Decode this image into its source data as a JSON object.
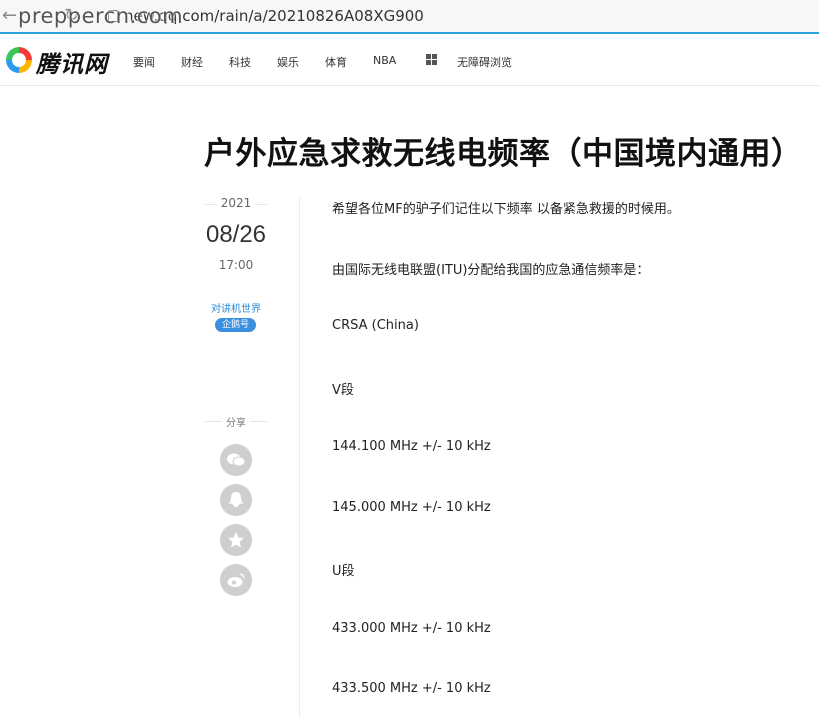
{
  "browser": {
    "back_glyph": "←",
    "reload_glyph": "↻",
    "watermark": "preppercn.com",
    "url": "new.qq.com/rain/a/20210826A08XG900"
  },
  "site": {
    "logo_text": "腾讯网",
    "nav": [
      "要闻",
      "财经",
      "科技",
      "娱乐",
      "体育",
      "NBA"
    ],
    "accessibility": "无障碍浏览"
  },
  "article": {
    "title": "户外应急求救无线电频率（中国境内通用）",
    "year": "2021",
    "date": "08/26",
    "time": "17:00",
    "author": "对讲机世界",
    "badge": "企鹅号",
    "share_label": "分享",
    "paragraphs": [
      "希望各位MF的驴子们记住以下频率 以备紧急救援的时候用。",
      "由国际无线电联盟(ITU)分配给我国的应急通信频率是：",
      "CRSA (China)",
      "V段",
      "144.100 MHz +/- 10 kHz",
      "145.000 MHz +/- 10 kHz",
      "U段",
      "433.000 MHz +/- 10 kHz",
      "433.500 MHz +/- 10 kHz"
    ]
  },
  "icons": {
    "share": [
      "wechat-icon",
      "qq-icon",
      "star-icon",
      "weibo-icon"
    ],
    "colors": {
      "accent": "#2aa4e0",
      "badge": "#3a8fe0",
      "share_bg": "#cfcfcf"
    }
  }
}
